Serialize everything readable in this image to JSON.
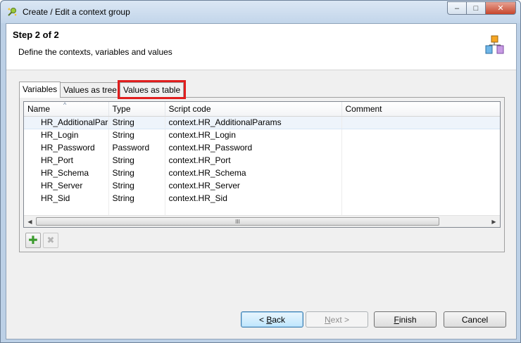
{
  "window": {
    "title": "Create / Edit a context group",
    "icon": "context-group-icon",
    "controls": {
      "minimize": "–",
      "maximize": "□",
      "close": "✕"
    }
  },
  "header": {
    "title": "Step 2 of 2",
    "description": "Define the contexts, variables and values",
    "icon": "wizard-context-icon"
  },
  "tabs": [
    {
      "label": "Variables",
      "active": true
    },
    {
      "label": "Values as tree",
      "active": false
    },
    {
      "label": "Values as table",
      "active": false,
      "highlighted": true
    }
  ],
  "table": {
    "columns": [
      "Name",
      "Type",
      "Script code",
      "Comment"
    ],
    "sorted_column": "Name",
    "sort_glyph": "^",
    "rows": [
      {
        "name": "HR_AdditionalParams",
        "type": "String",
        "script": "context.HR_AdditionalParams",
        "comment": ""
      },
      {
        "name": "HR_Login",
        "type": "String",
        "script": "context.HR_Login",
        "comment": ""
      },
      {
        "name": "HR_Password",
        "type": "Password",
        "script": "context.HR_Password",
        "comment": ""
      },
      {
        "name": "HR_Port",
        "type": "String",
        "script": "context.HR_Port",
        "comment": ""
      },
      {
        "name": "HR_Schema",
        "type": "String",
        "script": "context.HR_Schema",
        "comment": ""
      },
      {
        "name": "HR_Server",
        "type": "String",
        "script": "context.HR_Server",
        "comment": ""
      },
      {
        "name": "HR_Sid",
        "type": "String",
        "script": "context.HR_Sid",
        "comment": ""
      }
    ],
    "scrollbar": {
      "left_arrow": "◀",
      "right_arrow": "▶",
      "grip": "III"
    }
  },
  "toolbar": {
    "add": {
      "glyph": "✚",
      "icon": "add-icon"
    },
    "remove": {
      "glyph": "✖",
      "icon": "remove-icon"
    }
  },
  "buttons": {
    "back": {
      "prefix": "< ",
      "mnemonic": "B",
      "rest": "ack"
    },
    "next": {
      "mnemonic": "N",
      "rest": "ext >"
    },
    "finish": {
      "mnemonic": "F",
      "rest": "inish"
    },
    "cancel": "Cancel"
  },
  "colors": {
    "highlight": "#e01e1e",
    "selection_row": "#eef4fb",
    "default_button": "#bee6fd",
    "close_button": "#c7462c"
  }
}
